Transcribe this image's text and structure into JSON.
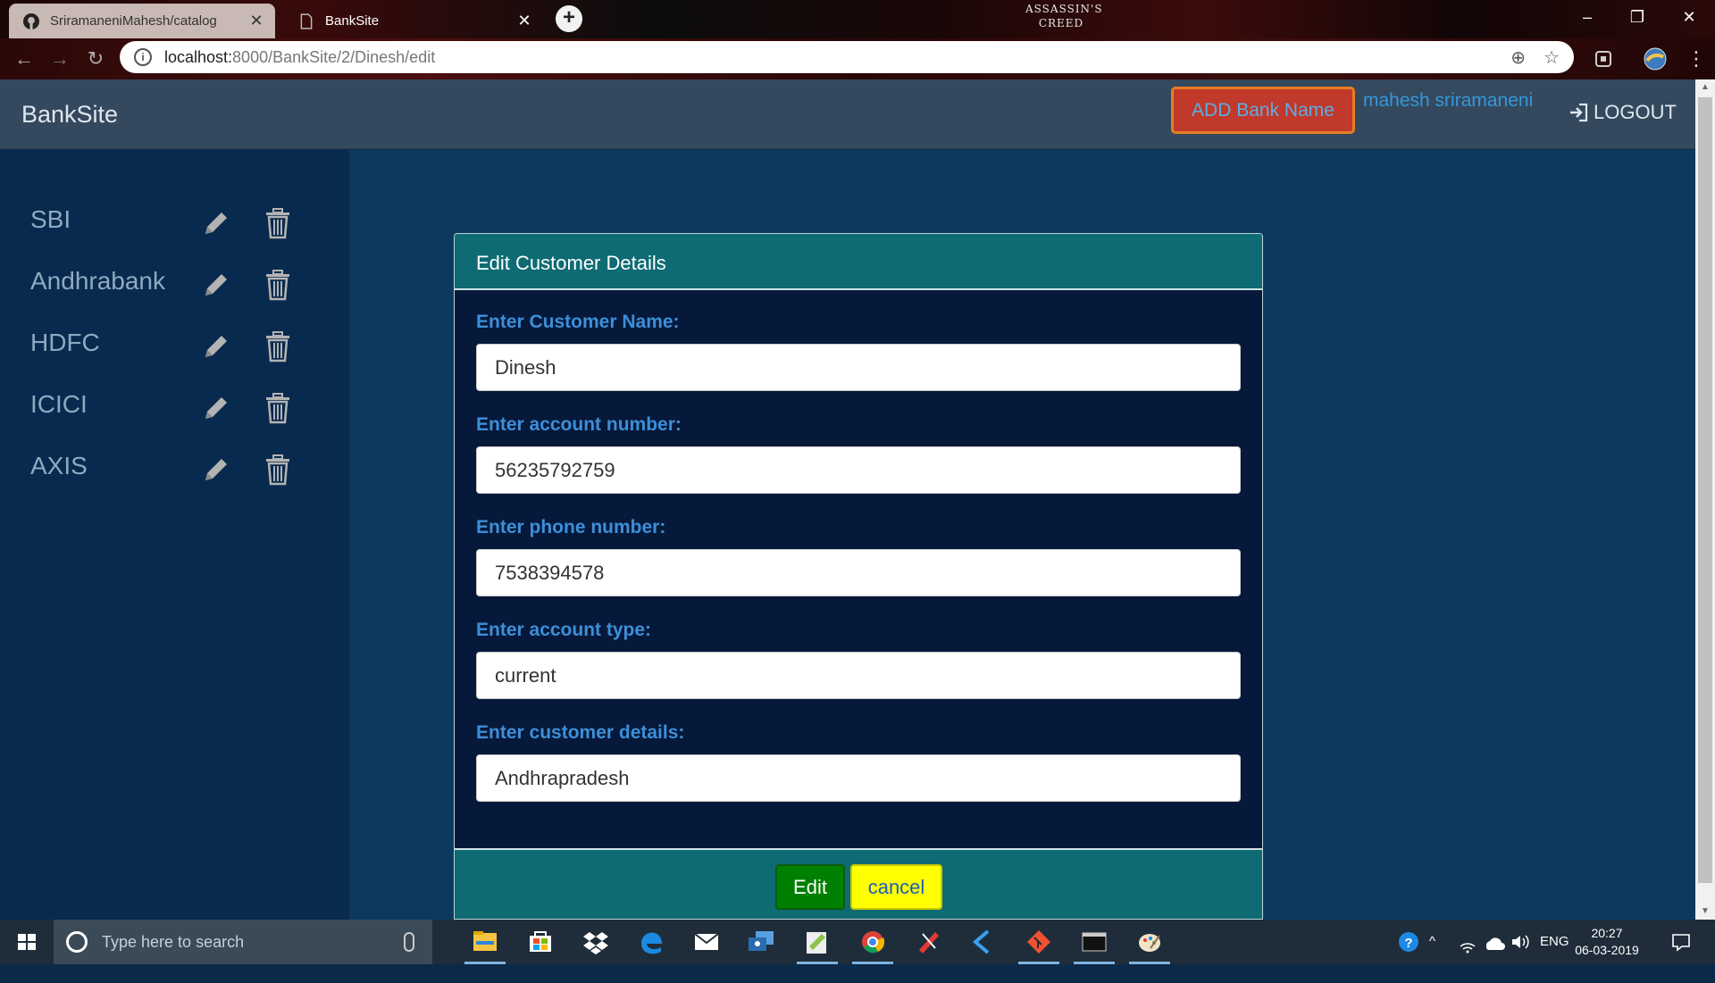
{
  "browser": {
    "tabs": [
      {
        "title": "SriramaneniMahesh/catalog",
        "active": false
      },
      {
        "title": "BankSite",
        "active": true
      }
    ],
    "url_host": "localhost:",
    "url_path": "8000/BankSite/2/Dinesh/edit",
    "theme_logo": "ASSASSIN'S CREED"
  },
  "navbar": {
    "brand": "BankSite",
    "add_bank_label": "ADD Bank Name",
    "username": "mahesh sriramaneni",
    "logout_label": "LOGOUT"
  },
  "sidebar": {
    "banks": [
      {
        "name": "SBI"
      },
      {
        "name": "Andhrabank"
      },
      {
        "name": "HDFC"
      },
      {
        "name": "ICICI"
      },
      {
        "name": "AXIS"
      }
    ]
  },
  "form": {
    "title": "Edit Customer Details",
    "fields": [
      {
        "label": "Enter Customer Name:",
        "value": "Dinesh"
      },
      {
        "label": "Enter account number:",
        "value": "56235792759"
      },
      {
        "label": "Enter phone number:",
        "value": "7538394578"
      },
      {
        "label": "Enter account type:",
        "value": "current"
      },
      {
        "label": "Enter customer details:",
        "value": "Andhrapradesh"
      }
    ],
    "submit_label": "Edit",
    "cancel_label": "cancel"
  },
  "taskbar": {
    "search_placeholder": "Type here to search",
    "language": "ENG",
    "time": "20:27",
    "date": "06-03-2019"
  },
  "colors": {
    "panel_header": "#0e6b73",
    "label_blue": "#3d8fd9",
    "edit_button": "#008000",
    "cancel_button": "#ffff00",
    "add_bank_button": "#c0392b",
    "sidebar": "#082a4e"
  }
}
